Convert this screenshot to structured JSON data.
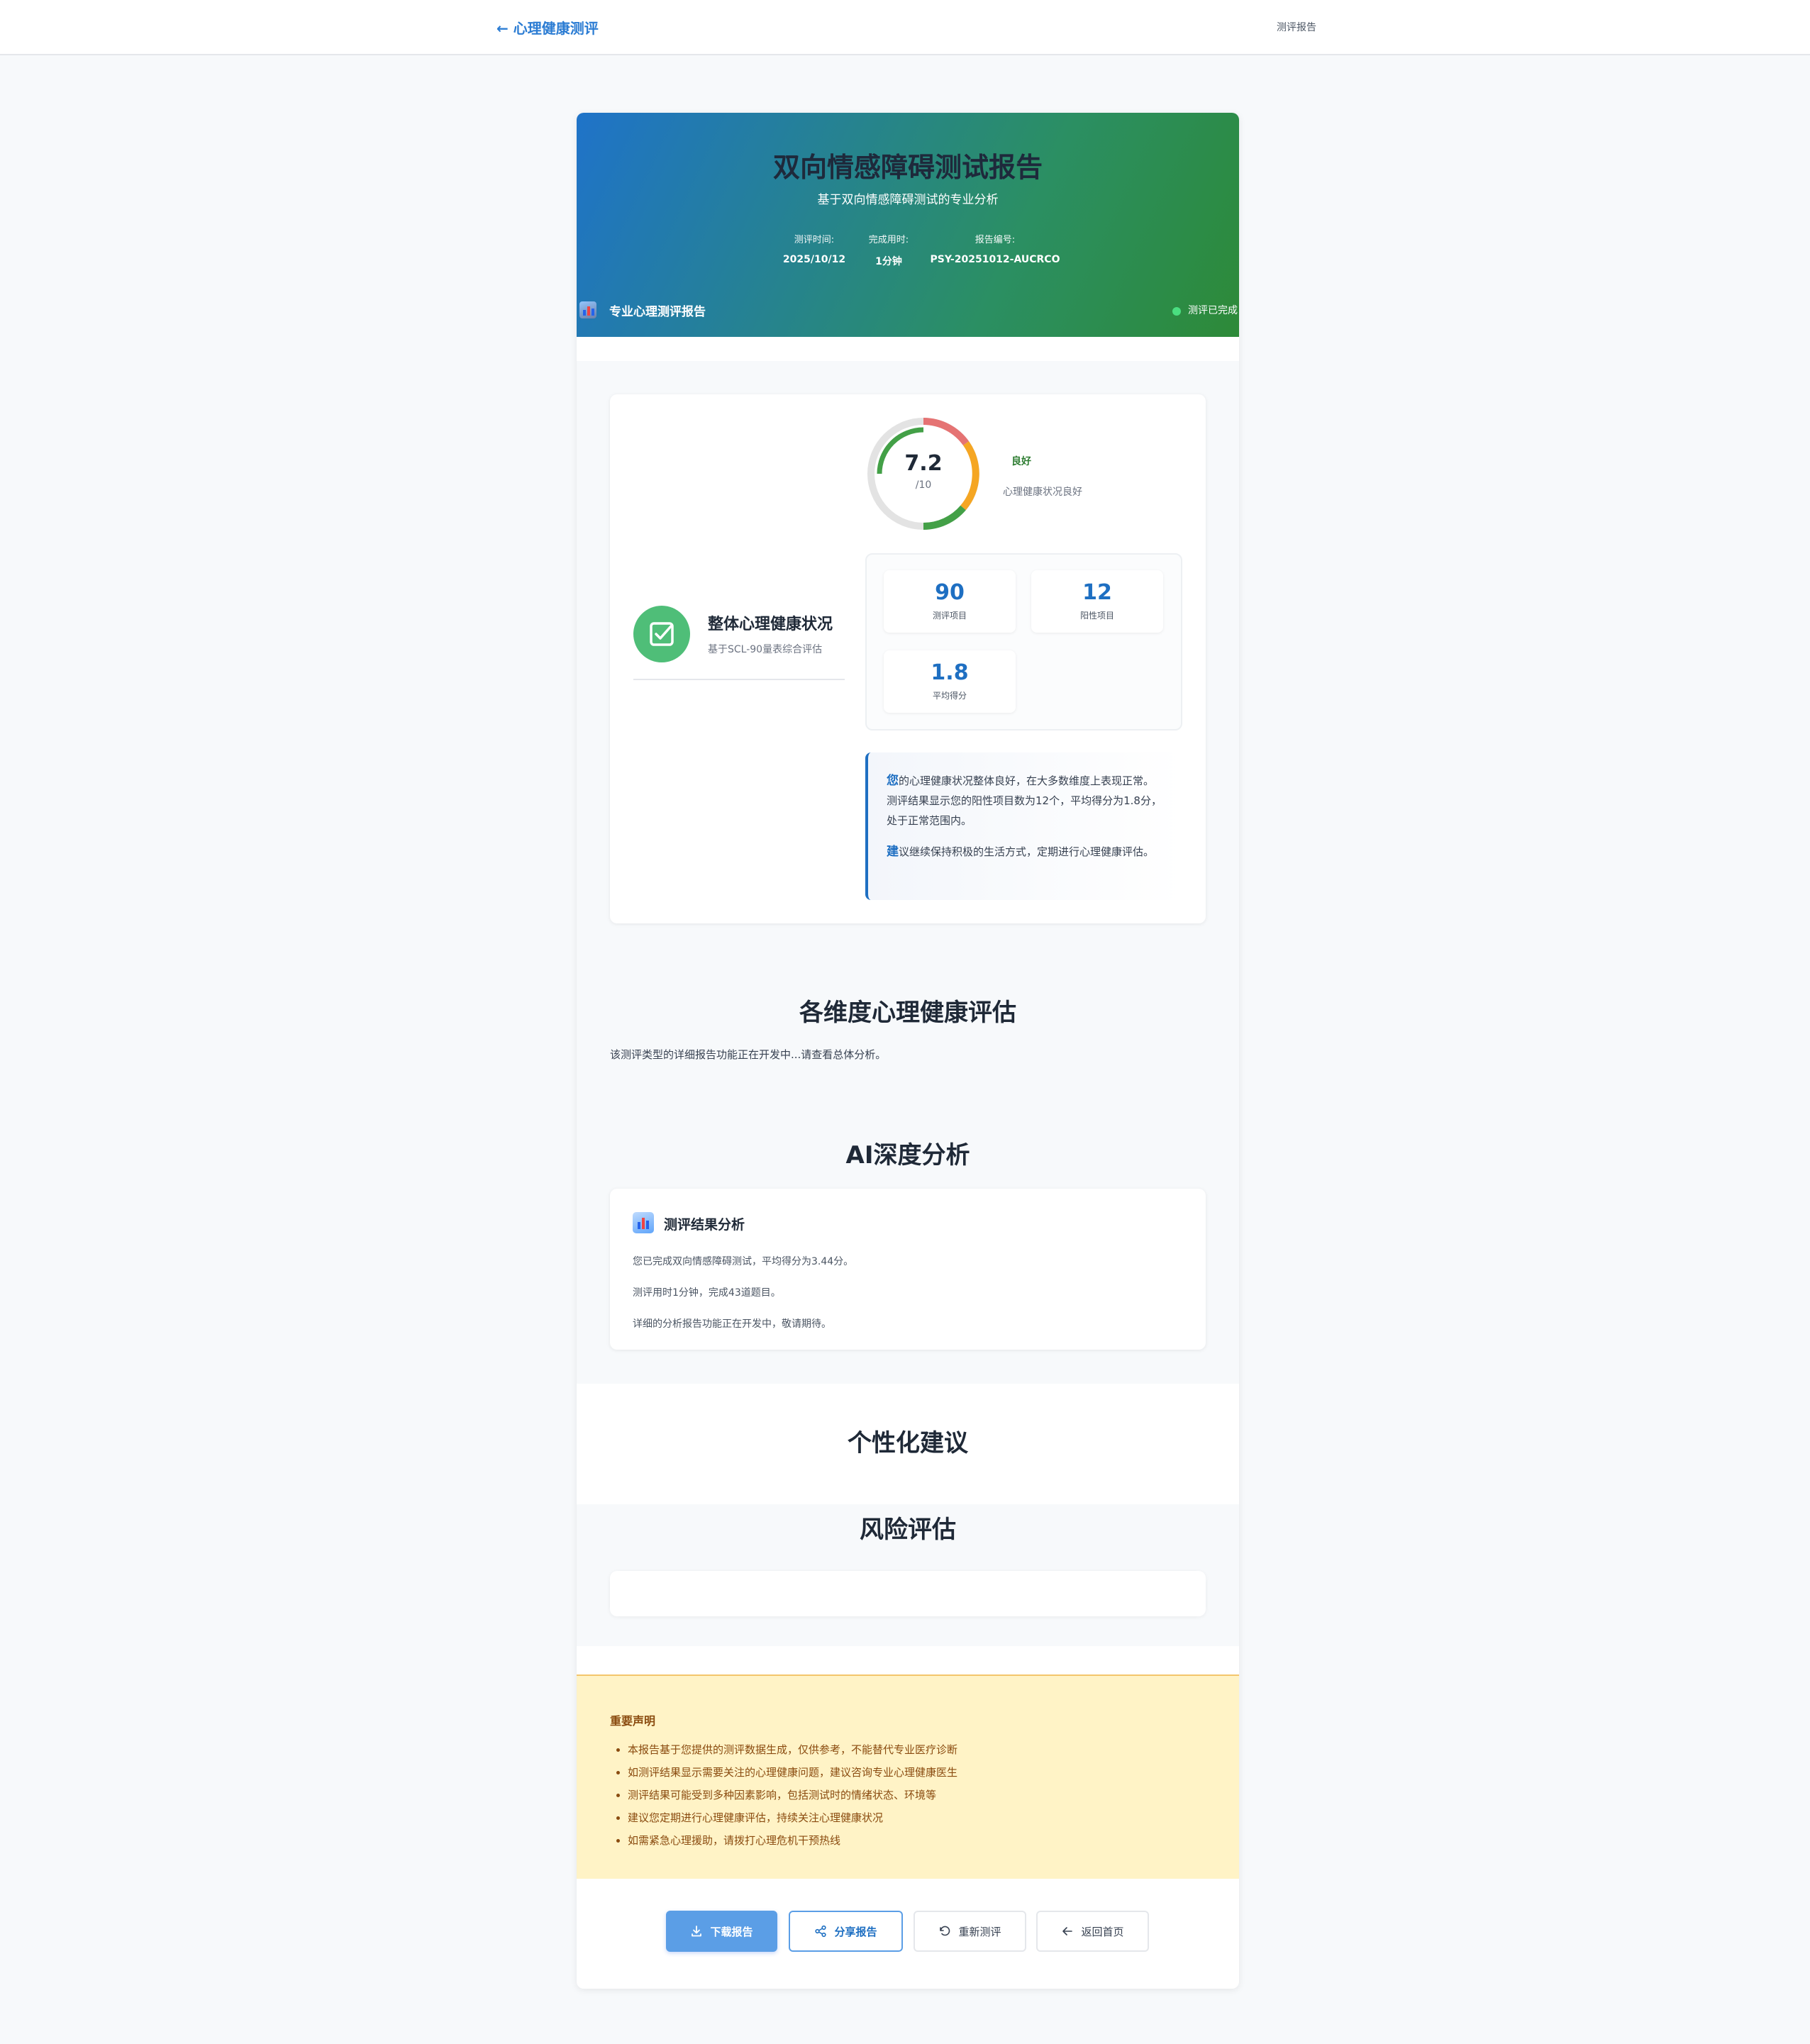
{
  "topbar": {
    "back_label": "← 心理健康测评",
    "title": "测评报告"
  },
  "header": {
    "title": "双向情感障碍测试报告",
    "subtitle": "基于双向情感障碍测试的专业分析",
    "meta": {
      "time_label": "测评时间:",
      "time_value": "2025/10/12",
      "duration_label": "完成用时:",
      "duration_value": "1分钟",
      "id_label": "报告编号:",
      "id_value": "PSY-20251012-AUCRCO"
    },
    "report_type": "专业心理测评报告",
    "status": "测评已完成"
  },
  "overall": {
    "title": "整体心理健康状况",
    "subtitle": "基于SCL-90量表综合评估",
    "score": "7.2",
    "score_max": "/10",
    "level": "良好",
    "level_desc": "心理健康状况良好",
    "stats": [
      {
        "value": "90",
        "label": "测评项目"
      },
      {
        "value": "12",
        "label": "阳性项目"
      },
      {
        "value": "1.8",
        "label": "平均得分"
      }
    ],
    "analysis": {
      "p1_lead": "您",
      "p1_text": "的心理健康状况整体良好，在大多数维度上表现正常。测评结果显示您的阳性项目数为12个，平均得分为1.8分，处于正常范围内。",
      "p2_lead": "建",
      "p2_text": "议继续保持积极的生活方式，定期进行心理健康评估。"
    }
  },
  "dimensions": {
    "title": "各维度心理健康评估",
    "note": "该测评类型的详细报告功能正在开发中...请查看总体分析。"
  },
  "ai": {
    "title": "AI深度分析",
    "card_title": "测评结果分析",
    "lines": [
      "您已完成双向情感障碍测试，平均得分为3.44分。",
      "测评用时1分钟，完成43道题目。",
      "详细的分析报告功能正在开发中，敬请期待。"
    ]
  },
  "advice": {
    "title": "个性化建议"
  },
  "risk": {
    "title": "风险评估"
  },
  "disclaimer": {
    "title": "重要声明",
    "items": [
      "本报告基于您提供的测评数据生成，仅供参考，不能替代专业医疗诊断",
      "如测评结果显示需要关注的心理健康问题，建议咨询专业心理健康医生",
      "测评结果可能受到多种因素影响，包括测试时的情绪状态、环境等",
      "建议您定期进行心理健康评估，持续关注心理健康状况",
      "如需紧急心理援助，请拨打心理危机干预热线"
    ]
  },
  "actions": {
    "download": "下载报告",
    "share": "分享报告",
    "retest": "重新测评",
    "home": "返回首页"
  },
  "colors": {
    "accent": "#1e6fc2",
    "good": "#2e7d32",
    "header_gradient_start": "#1f73c9",
    "header_gradient_end": "#2d8a38",
    "disclaimer_bg": "#fff3c6"
  },
  "icons": {
    "check": "check-square-icon",
    "chart": "bar-chart-icon",
    "download": "download-icon",
    "share": "share-icon",
    "retest": "rotate-ccw-icon",
    "home": "arrow-left-icon"
  }
}
